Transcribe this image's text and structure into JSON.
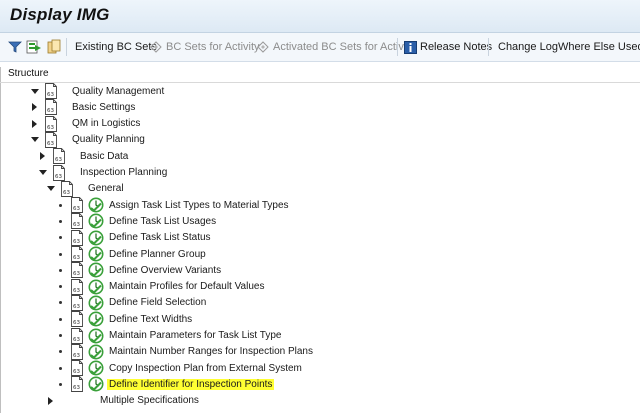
{
  "window": {
    "title": "Display IMG"
  },
  "toolbar": {
    "existing_bc_sets": "Existing BC Sets",
    "bc_sets_for_activity": "BC Sets for Activity",
    "activated_bc_sets_for_activity": "Activated BC Sets for Activity",
    "release_notes": "Release Notes",
    "change_log": "Change Log",
    "where_else_used": "Where Else Used"
  },
  "structure": {
    "header": "Structure",
    "nodes": [
      {
        "label": "Quality Management",
        "level": 0,
        "state": "expanded",
        "clock": false,
        "highlighted": false
      },
      {
        "label": "Basic Settings",
        "level": 1,
        "state": "collapsed",
        "clock": false,
        "highlighted": false
      },
      {
        "label": "QM in Logistics",
        "level": 1,
        "state": "collapsed",
        "clock": false,
        "highlighted": false
      },
      {
        "label": "Quality Planning",
        "level": 1,
        "state": "expanded",
        "clock": false,
        "highlighted": false
      },
      {
        "label": "Basic Data",
        "level": 2,
        "state": "collapsed",
        "clock": false,
        "highlighted": false
      },
      {
        "label": "Inspection Planning",
        "level": 2,
        "state": "expanded",
        "clock": false,
        "highlighted": false
      },
      {
        "label": "General",
        "level": 3,
        "state": "expanded",
        "clock": false,
        "highlighted": false
      },
      {
        "label": "Assign Task List Types to Material Types",
        "level": 4,
        "state": "leaf",
        "clock": true,
        "highlighted": false
      },
      {
        "label": "Define Task List Usages",
        "level": 4,
        "state": "leaf",
        "clock": true,
        "highlighted": false
      },
      {
        "label": "Define Task List Status",
        "level": 4,
        "state": "leaf",
        "clock": true,
        "highlighted": false
      },
      {
        "label": "Define Planner Group",
        "level": 4,
        "state": "leaf",
        "clock": true,
        "highlighted": false
      },
      {
        "label": "Define Overview Variants",
        "level": 4,
        "state": "leaf",
        "clock": true,
        "highlighted": false
      },
      {
        "label": "Maintain Profiles for Default Values",
        "level": 4,
        "state": "leaf",
        "clock": true,
        "highlighted": false
      },
      {
        "label": "Define Field Selection",
        "level": 4,
        "state": "leaf",
        "clock": true,
        "highlighted": false
      },
      {
        "label": "Define Text Widths",
        "level": 4,
        "state": "leaf",
        "clock": true,
        "highlighted": false
      },
      {
        "label": "Maintain Parameters for Task List Type",
        "level": 4,
        "state": "leaf",
        "clock": true,
        "highlighted": false
      },
      {
        "label": "Maintain Number Ranges for Inspection Plans",
        "level": 4,
        "state": "leaf",
        "clock": true,
        "highlighted": false
      },
      {
        "label": "Copy Inspection Plan from External System",
        "level": 4,
        "state": "leaf",
        "clock": true,
        "highlighted": false
      },
      {
        "label": "Define Identifier for Inspection Points",
        "level": 4,
        "state": "leaf",
        "clock": true,
        "highlighted": true
      },
      {
        "label": "Multiple Specifications",
        "level": 3,
        "state": "collapsed",
        "clock": false,
        "highlighted": false,
        "no_icon": true
      }
    ]
  },
  "colors": {
    "highlight": "#ffff33",
    "title_bg": "#dde9f4",
    "clock_green": "#3aa03a"
  }
}
